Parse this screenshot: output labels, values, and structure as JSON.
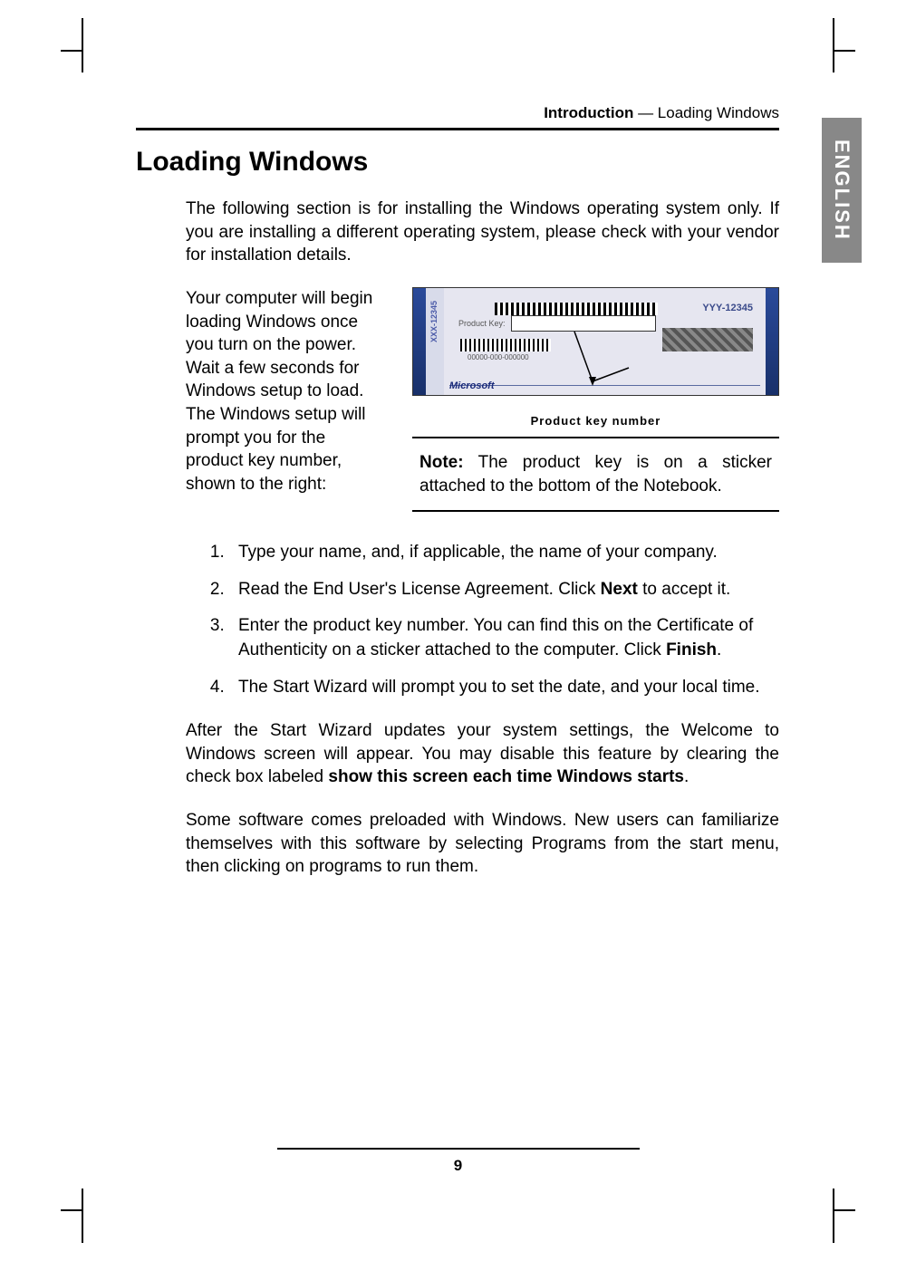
{
  "running_head": {
    "bold": "Introduction",
    "sep": " — ",
    "rest": "Loading Windows"
  },
  "side_tab": "ENGLISH",
  "heading": "Loading Windows",
  "intro": "The following section is for installing the Windows operating system only. If you are installing a different operating system, please check with your vendor for installation details.",
  "left_col": "Your computer will begin loading Windows once you turn on the power. Wait a few seconds for Windows setup to load. The Windows setup will prompt you for the product key number, shown to the right:",
  "figure": {
    "vert_label": "XXX-12345",
    "product_key_label": "Product Key:",
    "num_text": "00000-000-000000",
    "yyy": "YYY-12345",
    "msft": "Microsoft",
    "caption": "Product key number"
  },
  "note": {
    "label": "Note:",
    "text": " The product key is on a sticker attached to the bottom of the Notebook."
  },
  "steps": [
    "Type your name, and, if applicable, the name of your company.",
    {
      "pre": "Read the End User's License Agreement. Click ",
      "bold": "Next",
      "post": " to accept it."
    },
    {
      "pre": "Enter the product key number. You can find this on the Certificate of Authenticity on a sticker attached to the computer. Click ",
      "bold": "Finish",
      "post": "."
    },
    "The Start Wizard will prompt you to set the date, and your local time."
  ],
  "after1": {
    "pre": "After the Start Wizard updates your system settings, the Welcome to Windows screen will appear. You may disable this feature by clearing the check box labeled ",
    "bold": "show this screen each time Windows starts",
    "post": "."
  },
  "after2": "Some software comes preloaded with Windows. New users can familiarize themselves with this software by selecting Programs from the start menu, then clicking on programs to run them.",
  "page_number": "9"
}
